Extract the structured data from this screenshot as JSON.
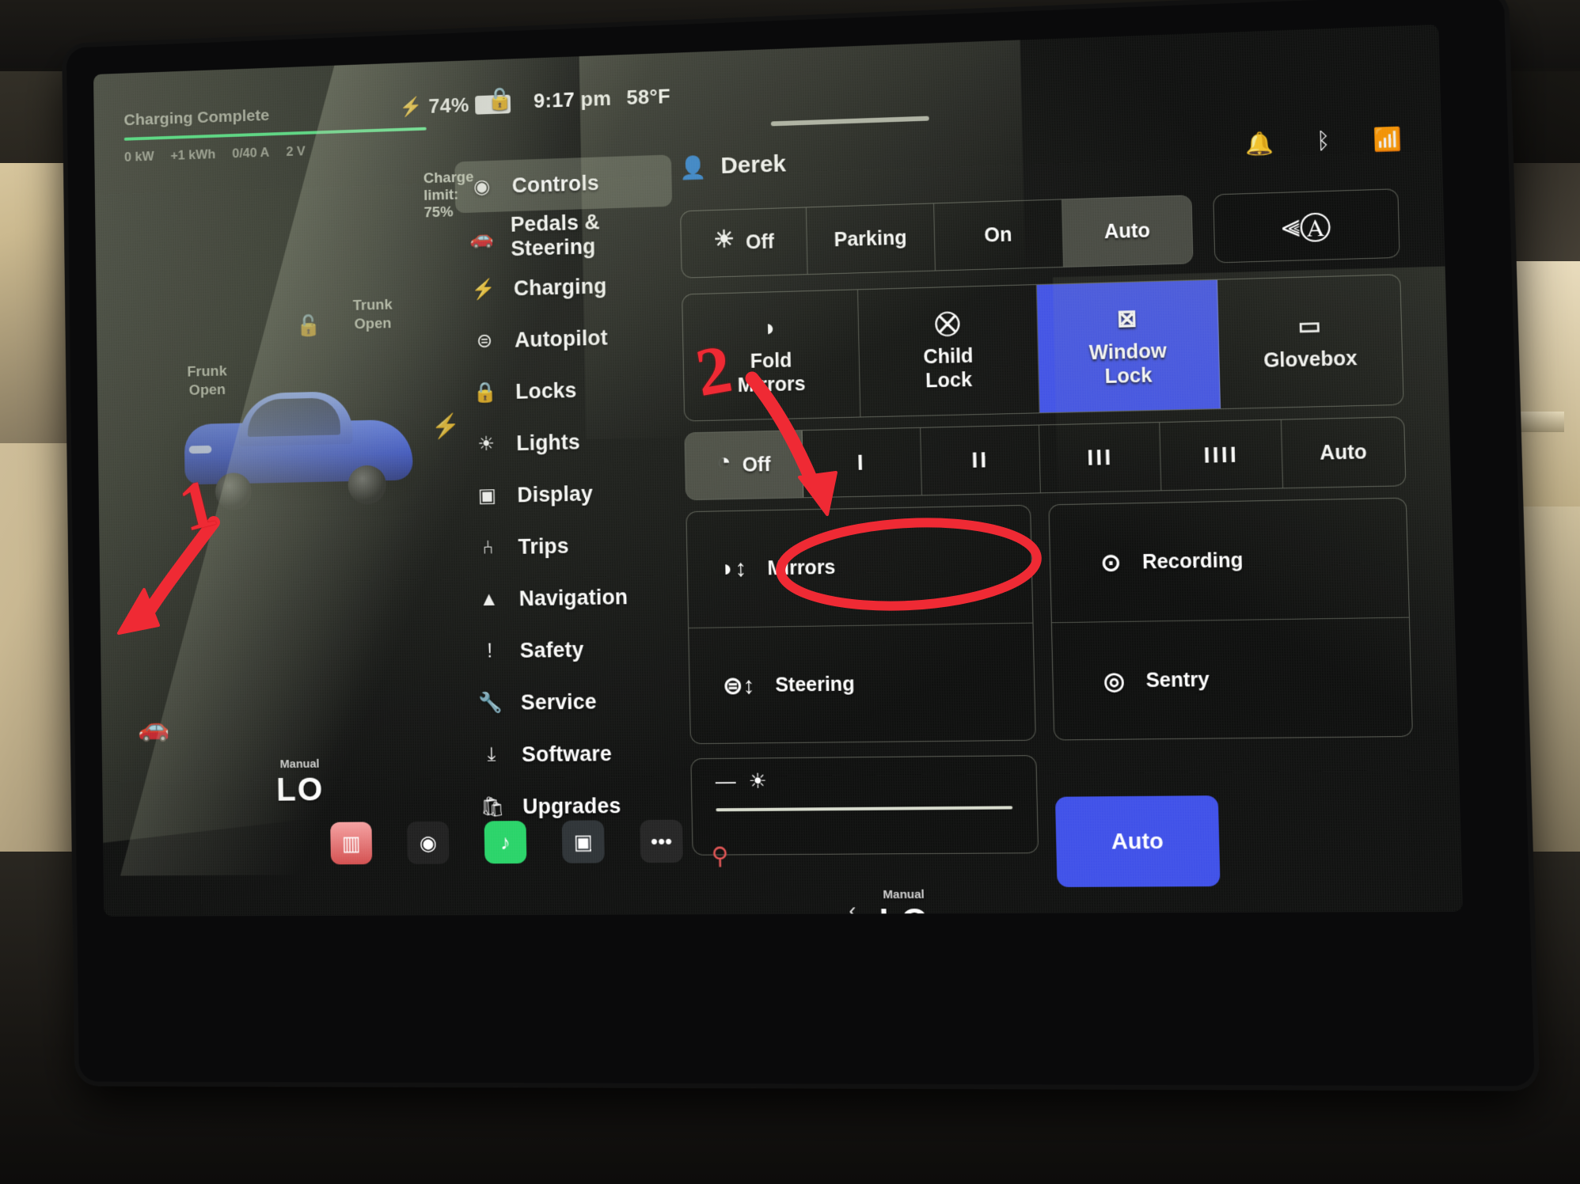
{
  "statusbar": {
    "battery_percent": "74%",
    "bolt_icon": "bolt-icon",
    "lock_icon": "unlocked-padlock-icon",
    "time": "9:17 pm",
    "temperature": "58°F"
  },
  "charging": {
    "title": "Charging Complete",
    "stats": [
      "0 kW",
      "+1 kWh",
      "0/40 A",
      "2 V"
    ],
    "charge_limit": "Charge limit: 75%",
    "bar_color": "#3dff86"
  },
  "car_visual": {
    "trunk_label": "Trunk\nOpen",
    "trunk_line1": "Trunk",
    "trunk_line2": "Open",
    "frunk_line1": "Frunk",
    "frunk_line2": "Open",
    "lock_icon": "open-padlock-icon",
    "bolt_icon": "charge-port-bolt-icon",
    "car_color": "#2742c9"
  },
  "sidebar": {
    "items": [
      {
        "label": "Controls",
        "icon": "toggle-switch-icon",
        "active": true
      },
      {
        "label": "Pedals & Steering",
        "icon": "car-front-icon",
        "active": false
      },
      {
        "label": "Charging",
        "icon": "bolt-icon",
        "active": false
      },
      {
        "label": "Autopilot",
        "icon": "steering-wheel-icon",
        "active": false
      },
      {
        "label": "Locks",
        "icon": "padlock-icon",
        "active": false
      },
      {
        "label": "Lights",
        "icon": "sun-icon",
        "active": false
      },
      {
        "label": "Display",
        "icon": "screen-icon",
        "active": false
      },
      {
        "label": "Trips",
        "icon": "route-icon",
        "active": false
      },
      {
        "label": "Navigation",
        "icon": "navigation-arrow-icon",
        "active": false
      },
      {
        "label": "Safety",
        "icon": "exclamation-circle-icon",
        "active": false
      },
      {
        "label": "Service",
        "icon": "wrench-icon",
        "active": false
      },
      {
        "label": "Software",
        "icon": "download-icon",
        "active": false
      },
      {
        "label": "Upgrades",
        "icon": "shopping-bag-icon",
        "active": false
      }
    ]
  },
  "main": {
    "user_name": "Derek",
    "user_icon": "person-icon",
    "system_icons": [
      "bell-icon",
      "bluetooth-icon",
      "wifi-icon"
    ],
    "lights_row": {
      "options": [
        {
          "label": "Off",
          "icon": "headlight-icon",
          "selected": false
        },
        {
          "label": "Parking",
          "icon": "",
          "selected": false
        },
        {
          "label": "On",
          "icon": "",
          "selected": false
        },
        {
          "label": "Auto",
          "icon": "",
          "selected": true
        }
      ],
      "highbeam_icon": "auto-high-beam-icon"
    },
    "locks_row": {
      "options": [
        {
          "label": "Fold\nMirrors",
          "line1": "Fold",
          "line2": "Mirrors",
          "icon": "mirror-icon",
          "state": "off"
        },
        {
          "label": "Child\nLock",
          "line1": "Child",
          "line2": "Lock",
          "icon": "child-icon",
          "state": "off"
        },
        {
          "label": "Window\nLock",
          "line1": "Window",
          "line2": "Lock",
          "icon": "window-lock-icon",
          "state": "on"
        },
        {
          "label": "Glovebox",
          "line1": "Glovebox",
          "line2": "",
          "icon": "glovebox-icon",
          "state": "off"
        }
      ],
      "active_color": "#3b4de8"
    },
    "wiper_row": {
      "options": [
        {
          "label": "Off",
          "icon": "wiper-icon",
          "selected": true
        },
        {
          "label": "I",
          "icon": "",
          "selected": false
        },
        {
          "label": "II",
          "icon": "",
          "selected": false
        },
        {
          "label": "III",
          "icon": "",
          "selected": false
        },
        {
          "label": "IIII",
          "icon": "",
          "selected": false
        },
        {
          "label": "Auto",
          "icon": "",
          "selected": false
        }
      ]
    },
    "adjust_left": [
      {
        "label": "Mirrors",
        "icon": "mirror-adjust-icon"
      },
      {
        "label": "Steering",
        "icon": "steering-adjust-icon"
      }
    ],
    "adjust_right": [
      {
        "label": "Recording",
        "icon": "dashcam-record-icon"
      },
      {
        "label": "Sentry",
        "icon": "sentry-mode-icon"
      }
    ],
    "brightness": {
      "icon": "brightness-icon",
      "minus": "—"
    },
    "auto_button": "Auto"
  },
  "climate": {
    "left": {
      "mode": "Manual",
      "temp": "LO"
    },
    "right": {
      "mode": "Manual",
      "temp": "LO"
    },
    "prev_icon": "chevron-left-icon",
    "next_icon": "chevron-right-icon"
  },
  "taskbar": {
    "apps": [
      "media-app-icon",
      "camera-app-icon",
      "spotify-app-icon",
      "dashcam-app-icon",
      "more-apps-icon"
    ],
    "car_icon": "car-icon",
    "joystick_icon": "joystick-icon",
    "volume_icon": "volume-icon"
  },
  "annotations": {
    "marks": [
      {
        "label": "1",
        "type": "number-with-arrow",
        "color": "#ef2a34",
        "points_to": "car-icon-bottom-left"
      },
      {
        "label": "2",
        "type": "number-with-arrow",
        "color": "#ef2a34",
        "points_to": "recording-button"
      }
    ],
    "circle": {
      "target": "recording-button",
      "color": "#ef2a34"
    }
  }
}
